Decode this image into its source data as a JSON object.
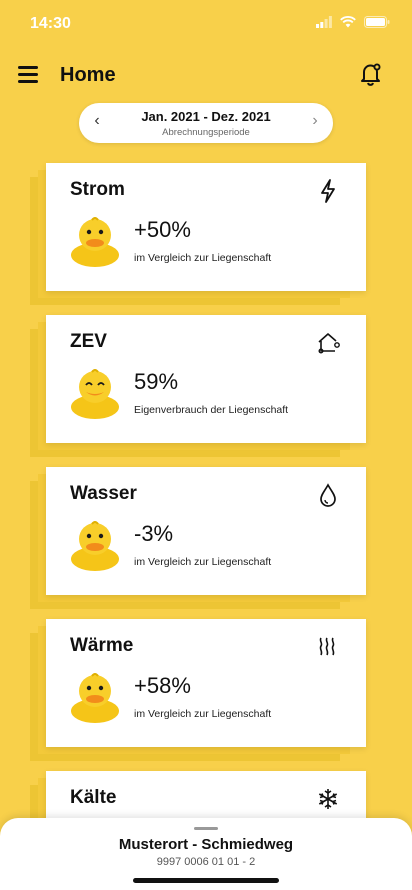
{
  "status": {
    "time": "14:30"
  },
  "header": {
    "title": "Home"
  },
  "period": {
    "range": "Jan. 2021 - Dez. 2021",
    "label": "Abrechnungsperiode",
    "prev": "‹",
    "next": "›"
  },
  "cards": [
    {
      "title": "Strom",
      "icon": "lightning-icon",
      "value": "+50%",
      "subtitle": "im Vergleich zur Liegenschaft",
      "duck_mood": "neutral"
    },
    {
      "title": "ZEV",
      "icon": "solar-house-icon",
      "value": "59%",
      "subtitle": "Eigenverbrauch der Liegenschaft",
      "duck_mood": "happy"
    },
    {
      "title": "Wasser",
      "icon": "water-drop-icon",
      "value": "-3%",
      "subtitle": "im Vergleich zur Liegenschaft",
      "duck_mood": "neutral"
    },
    {
      "title": "Wärme",
      "icon": "heat-waves-icon",
      "value": "+58%",
      "subtitle": "im Vergleich zur Liegenschaft",
      "duck_mood": "neutral"
    },
    {
      "title": "Kälte",
      "icon": "snowflake-icon"
    }
  ],
  "location": {
    "name": "Musterort - Schmiedweg",
    "id": "9997 0006 01 01 - 2"
  },
  "colors": {
    "background": "#F8D04A",
    "duck": "#F5C518",
    "beak": "#F28C1B"
  }
}
